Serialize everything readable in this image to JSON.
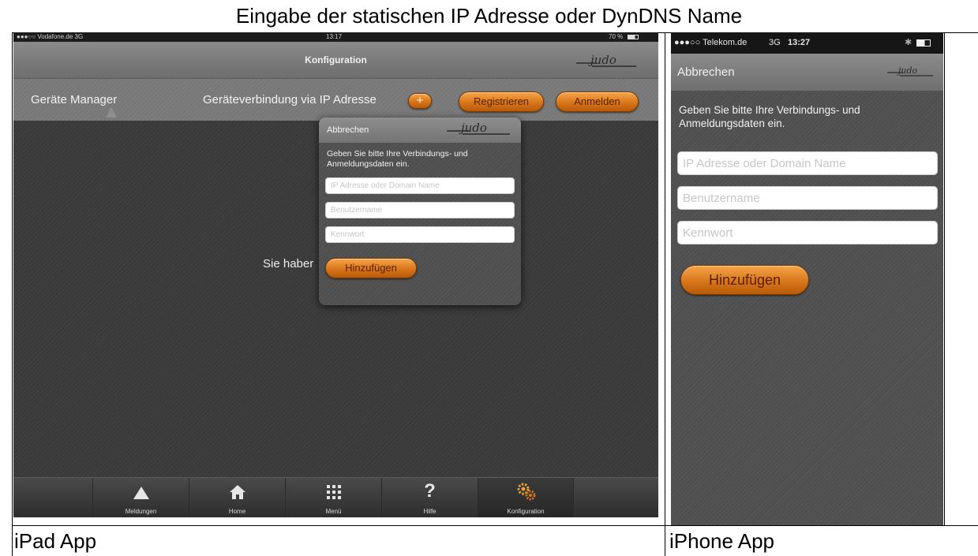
{
  "document": {
    "title": "Eingabe der statischen IP Adresse oder DynDNS Name",
    "ipad_caption": "iPad App",
    "iphone_caption": "iPhone App"
  },
  "ipad": {
    "status": {
      "carrier": "●●●○○ Vodafone.de  3G",
      "time": "13:17",
      "battery": "70 %"
    },
    "nav_title": "Konfiguration",
    "logo_text": "judo",
    "toolbar": {
      "manager_label": "Geräte Manager",
      "connection_label": "Geräteverbindung via IP Adresse",
      "add_symbol": "+",
      "register_label": "Registrieren",
      "login_label": "Anmelden"
    },
    "background_text": "Sie haber",
    "popover": {
      "cancel_label": "Abbrechen",
      "instructions": "Geben Sie bitte Ihre Verbindungs- und Anmeldungsdaten ein.",
      "ip_placeholder": "IP Adresse oder Domain Name",
      "user_placeholder": "Benutzername",
      "password_placeholder": "Kennwort",
      "add_button": "Hinzufügen"
    },
    "tabs": [
      {
        "label": "Meldungen",
        "icon": "warning-icon"
      },
      {
        "label": "Home",
        "icon": "home-icon"
      },
      {
        "label": "Menü",
        "icon": "grid-icon"
      },
      {
        "label": "Hilfe",
        "icon": "help-icon"
      },
      {
        "label": "Konfiguration",
        "icon": "gears-icon"
      }
    ],
    "active_tab": "Konfiguration"
  },
  "iphone": {
    "status": {
      "carrier": "●●●○○ Telekom.de",
      "network": "3G",
      "time": "13:27"
    },
    "cancel_label": "Abbrechen",
    "logo_text": "judo",
    "instructions": "Geben Sie bitte Ihre Verbindungs- und Anmeldungsdaten ein.",
    "ip_placeholder": "IP Adresse oder Domain Name",
    "user_placeholder": "Benutzername",
    "password_placeholder": "Kennwort",
    "add_button": "Hinzufügen"
  },
  "colors": {
    "accent_orange": "#d8761a",
    "nav_gray": "#7c7c7c",
    "body_dark": "#3a3a3a"
  }
}
